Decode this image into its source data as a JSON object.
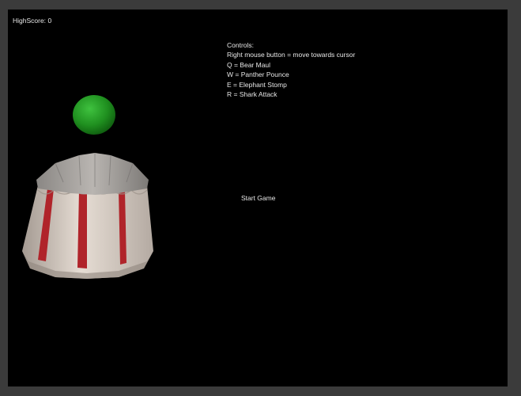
{
  "hud": {
    "highscore_label": "HighScore:",
    "highscore_value": "0"
  },
  "controls": {
    "title": "Controls:",
    "items": [
      "Right mouse button = move towards cursor",
      "Q = Bear Maul",
      "W = Panther Pounce",
      "E = Elephant Stomp",
      "R = Shark Attack"
    ]
  },
  "menu": {
    "start_label": "Start Game"
  },
  "colors": {
    "background": "#000000",
    "text": "#e8e8e8",
    "orb": "#1f8f1f",
    "tent_stripe": "#b0242a",
    "tent_canvas": "#d8d0c8"
  }
}
